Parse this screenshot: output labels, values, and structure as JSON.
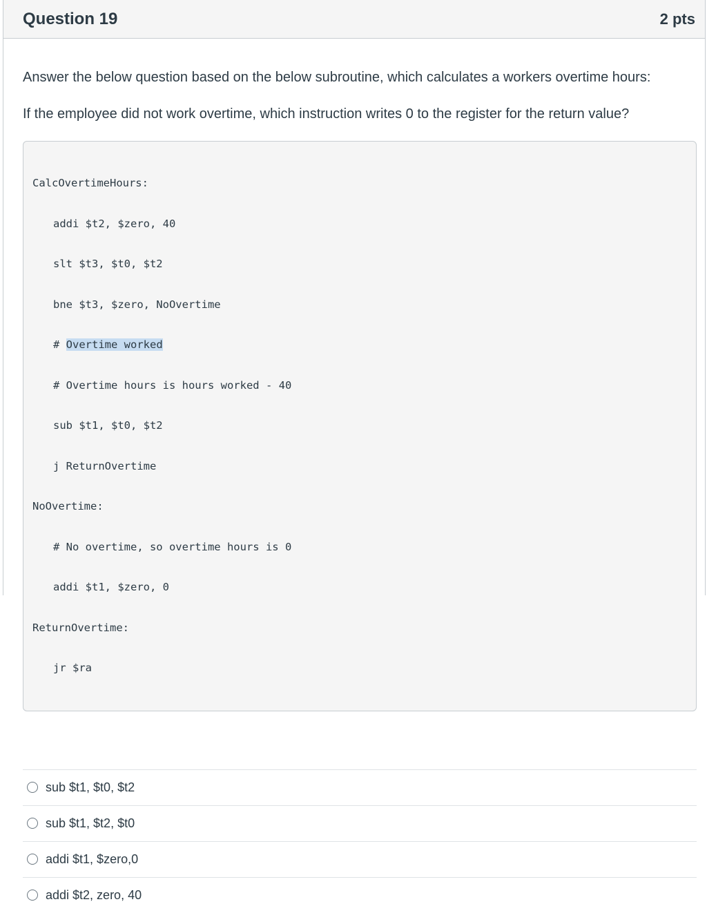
{
  "question": {
    "title": "Question 19",
    "points": "2 pts",
    "paragraph_1": "Answer the below question based on the below subroutine, which calculates a workers overtime hours:",
    "paragraph_2": "If the employee did not work overtime, which instruction writes 0 to the register for the return value?"
  },
  "code": {
    "lines": [
      {
        "text": "CalcOvertimeHours:",
        "indent": false
      },
      {
        "text": "addi $t2, $zero, 40",
        "indent": true
      },
      {
        "text": "slt $t3, $t0, $t2",
        "indent": true
      },
      {
        "text": "bne $t3, $zero, NoOvertime",
        "indent": true
      },
      {
        "prefix": "# ",
        "highlight": "Overtime worked",
        "indent": true
      },
      {
        "text": "# Overtime hours is hours worked - 40",
        "indent": true
      },
      {
        "text": "sub $t1, $t0, $t2",
        "indent": true
      },
      {
        "text": "j ReturnOvertime",
        "indent": true
      },
      {
        "text": "NoOvertime:",
        "indent": false
      },
      {
        "text": "# No overtime, so overtime hours is 0",
        "indent": true
      },
      {
        "text": "addi $t1, $zero, 0",
        "indent": true
      },
      {
        "text": "ReturnOvertime:",
        "indent": false
      },
      {
        "text": "jr $ra",
        "indent": true
      }
    ]
  },
  "answers": [
    {
      "label": "sub $t1, $t0, $t2",
      "selected": false
    },
    {
      "label": "sub $t1, $t2, $t0",
      "selected": false
    },
    {
      "label": "addi $t1, $zero,0",
      "selected": false
    },
    {
      "label": "addi $t2, zero, 40",
      "selected": false
    }
  ]
}
